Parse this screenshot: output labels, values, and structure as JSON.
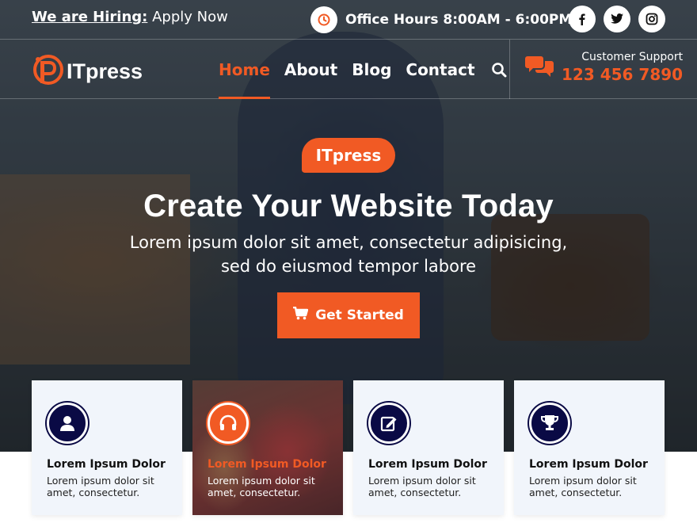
{
  "colors": {
    "accent": "#f15a24",
    "navy": "#0a0a45",
    "card_bg": "#f1f5fb"
  },
  "topbar": {
    "hiring_strong": "We are Hiring:",
    "hiring_rest": " Apply Now",
    "office_icon": "clock-icon",
    "office_hours": "Office Hours 8:00AM - 6:00PM",
    "socials": [
      {
        "name": "facebook-icon"
      },
      {
        "name": "twitter-icon"
      },
      {
        "name": "instagram-icon"
      }
    ]
  },
  "nav": {
    "logo_text": "ITpress",
    "links": [
      {
        "label": "Home",
        "active": true
      },
      {
        "label": "About",
        "active": false
      },
      {
        "label": "Blog",
        "active": false
      },
      {
        "label": "Contact",
        "active": false
      }
    ],
    "search_icon": "search-icon",
    "support_icon": "chat-icon",
    "support_label": "Customer Support",
    "support_phone": "123 456 7890"
  },
  "hero": {
    "badge": "ITpress",
    "title": "Create Your Website Today",
    "subtitle_line1": "Lorem ipsum dolor sit amet, consectetur adipisicing,",
    "subtitle_line2": "sed do eiusmod tempor labore",
    "cta_icon": "cart-icon",
    "cta_label": "Get Started"
  },
  "cards": [
    {
      "icon": "user-icon",
      "title": "Lorem Ipsum Dolor",
      "text": "Lorem ipsum dolor sit amet, consectetur."
    },
    {
      "icon": "headphones-icon",
      "title": "Lorem Ipsum Dolor",
      "text": "Lorem ipsum dolor sit amet, consectetur."
    },
    {
      "icon": "edit-icon",
      "title": "Lorem Ipsum Dolor",
      "text": "Lorem ipsum dolor sit amet, consectetur."
    },
    {
      "icon": "trophy-icon",
      "title": "Lorem Ipsum Dolor",
      "text": "Lorem ipsum dolor sit amet, consectetur."
    }
  ]
}
